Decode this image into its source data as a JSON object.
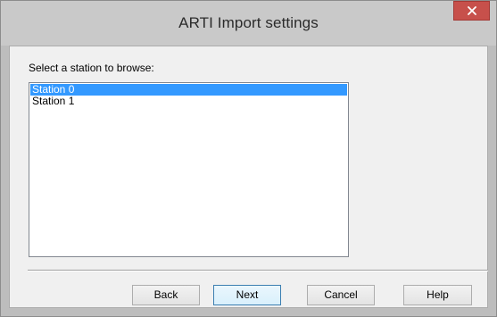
{
  "window": {
    "title": "ARTI Import settings",
    "close_icon": "close-icon"
  },
  "main": {
    "prompt": "Select a station to browse:",
    "stations": [
      {
        "label": "Station 0",
        "selected": true
      },
      {
        "label": "Station 1",
        "selected": false
      }
    ]
  },
  "buttons": {
    "back": "Back",
    "next": "Next",
    "cancel": "Cancel",
    "help": "Help"
  },
  "colors": {
    "selection": "#3399ff",
    "close_button": "#c7504b"
  }
}
